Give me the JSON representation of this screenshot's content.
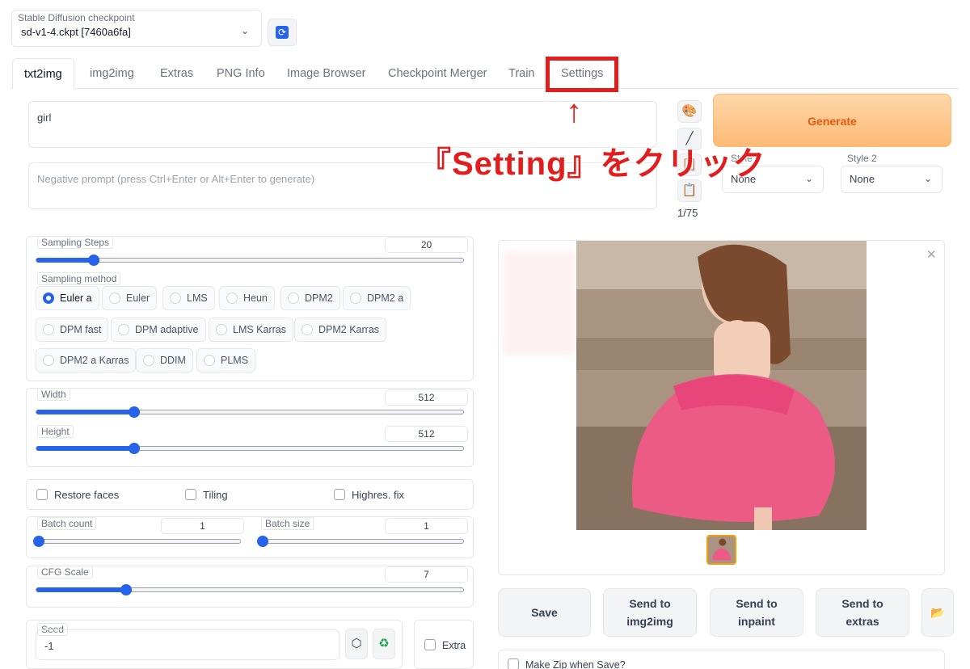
{
  "checkpoint": {
    "label": "Stable Diffusion checkpoint",
    "value": "sd-v1-4.ckpt [7460a6fa]",
    "refresh_icon": "refresh-icon"
  },
  "tabs": [
    {
      "label": "txt2img",
      "active": true
    },
    {
      "label": "img2img"
    },
    {
      "label": "Extras"
    },
    {
      "label": "PNG Info"
    },
    {
      "label": "Image Browser"
    },
    {
      "label": "Checkpoint Merger"
    },
    {
      "label": "Train"
    },
    {
      "label": "Settings"
    }
  ],
  "annotation": {
    "arrow": "↑",
    "text": "『Setting』をクリック",
    "color": "#e11d1d"
  },
  "prompt": {
    "value": "girl",
    "negative_placeholder": "Negative prompt (press Ctrl+Enter or Alt+Enter to generate)",
    "token_count": "1/75"
  },
  "tools": [
    "palette-icon",
    "pen-icon",
    "clipboard-icon",
    "clipboard-icon"
  ],
  "generate": {
    "label": "Generate"
  },
  "styles": [
    {
      "label": "Style 1",
      "value": "None"
    },
    {
      "label": "Style 2",
      "value": "None"
    }
  ],
  "sampling_steps": {
    "label": "Sampling Steps",
    "value": "20",
    "fraction": 0.135
  },
  "sampling_method": {
    "label": "Sampling method",
    "options": [
      "Euler a",
      "Euler",
      "LMS",
      "Heun",
      "DPM2",
      "DPM2 a",
      "DPM fast",
      "DPM adaptive",
      "LMS Karras",
      "DPM2 Karras",
      "DPM2 a Karras",
      "DDIM",
      "PLMS"
    ],
    "selected": "Euler a"
  },
  "width": {
    "label": "Width",
    "value": "512",
    "fraction": 0.23
  },
  "height": {
    "label": "Height",
    "value": "512",
    "fraction": 0.23
  },
  "checks": {
    "restore_faces": "Restore faces",
    "tiling": "Tiling",
    "highres_fix": "Highres. fix"
  },
  "batch_count": {
    "label": "Batch count",
    "value": "1",
    "fraction": 0.0
  },
  "batch_size": {
    "label": "Batch size",
    "value": "1",
    "fraction": 0.0
  },
  "cfg_scale": {
    "label": "CFG Scale",
    "value": "7",
    "fraction": 0.21
  },
  "seed": {
    "label": "Seed",
    "value": "-1",
    "extra": "Extra"
  },
  "output": {
    "close_icon": "close-icon",
    "buttons": {
      "save": "Save",
      "send_img2img_1": "Send to",
      "send_img2img_2": "img2img",
      "send_inpaint_1": "Send to",
      "send_inpaint_2": "inpaint",
      "send_extras_1": "Send to",
      "send_extras_2": "extras"
    },
    "zip_label": "Make Zip when Save?"
  }
}
